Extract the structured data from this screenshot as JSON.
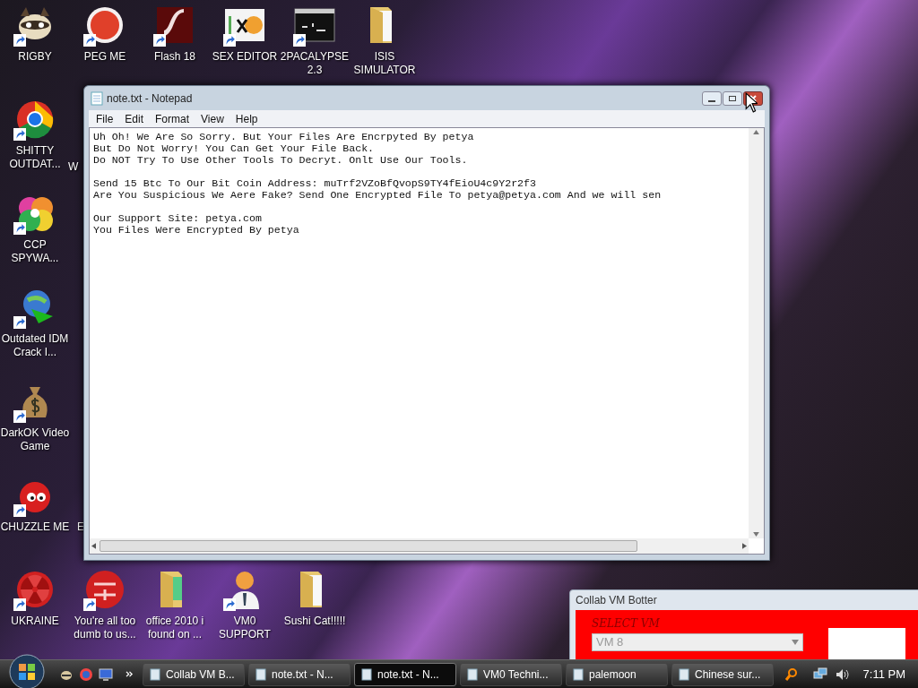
{
  "desktop": {
    "top_row": [
      {
        "label": "RIGBY",
        "shortcut": true
      },
      {
        "label": "PEG ME",
        "shortcut": true
      },
      {
        "label": "Flash 18",
        "shortcut": true
      },
      {
        "label": "SEX EDITOR",
        "shortcut": true
      },
      {
        "label": "2PACALYPSE 2.3",
        "shortcut": true
      },
      {
        "label": "ISIS SIMULATOR",
        "shortcut": false
      }
    ],
    "left_column": [
      {
        "label": "SHITTY OUTDAT...",
        "shortcut": true
      },
      {
        "label": "CCP SPYWA...",
        "shortcut": true
      },
      {
        "label": "Outdated IDM Crack I...",
        "shortcut": true
      },
      {
        "label": "DarkOK Video Game",
        "shortcut": true
      },
      {
        "label": "CHUZZLE ME",
        "shortcut": true
      }
    ],
    "partial_labels": [
      "W",
      "E"
    ],
    "bottom_row": [
      {
        "label": "UKRAINE",
        "shortcut": true
      },
      {
        "label": "You're all too dumb to us...",
        "shortcut": true
      },
      {
        "label": "office 2010 i found on ...",
        "shortcut": false
      },
      {
        "label": "VM0 SUPPORT",
        "shortcut": true
      },
      {
        "label": "Sushi Cat!!!!!",
        "shortcut": false
      }
    ]
  },
  "notepad": {
    "title": "note.txt - Notepad",
    "menu": [
      "File",
      "Edit",
      "Format",
      "View",
      "Help"
    ],
    "paragraphs": [
      [
        "Uh Oh! We Are So Sorry. But Your Files Are Encrpyted By petya",
        "But Do Not Worry! You Can Get Your File Back.",
        "Do NOT Try To Use Other Tools To Decryt. Onlt Use Our Tools."
      ],
      [
        "Send 15 Btc To Our Bit Coin Address: muTrf2VZoBfQvopS9TY4fEioU4c9Y2r2f3",
        "Are You Suspicious We Aere Fake? Send One Encrypted File To petya@petya.com And we will sen"
      ],
      [
        "Our Support Site: petya.com",
        "You Files Were Encrypted By petya"
      ]
    ]
  },
  "botter": {
    "title": "Collab VM Botter",
    "label": "SELECT VM",
    "value": "VM 8"
  },
  "taskbar": {
    "buttons": [
      {
        "label": "Collab VM B...",
        "selected": false
      },
      {
        "label": "note.txt - N...",
        "selected": false
      },
      {
        "label": "note.txt - N...",
        "selected": true
      },
      {
        "label": "VM0 Techni...",
        "selected": false
      },
      {
        "label": "palemoon",
        "selected": false
      },
      {
        "label": "Chinese sur...",
        "selected": false
      }
    ],
    "time": "7:11 PM"
  }
}
